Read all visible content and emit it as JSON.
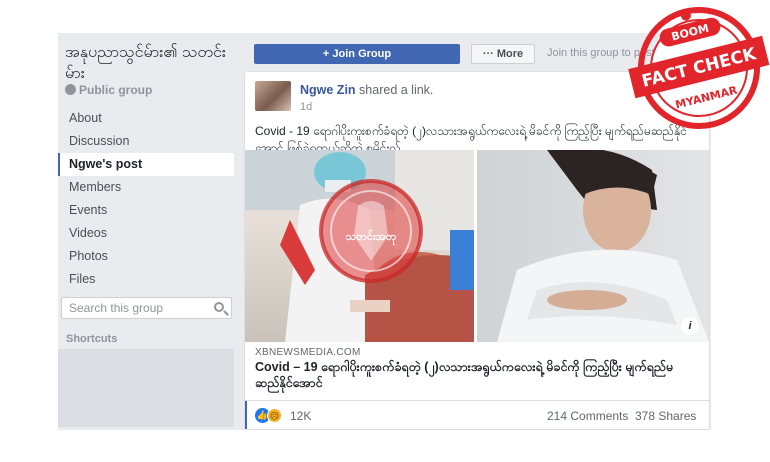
{
  "group": {
    "title": "အနုပညာသွင်မ်ား၏ သတင်းမ်ား",
    "type_label": "Public group"
  },
  "nav": {
    "items": [
      {
        "label": "About"
      },
      {
        "label": "Discussion"
      },
      {
        "label": "Ngwe's post"
      },
      {
        "label": "Members"
      },
      {
        "label": "Events"
      },
      {
        "label": "Videos"
      },
      {
        "label": "Photos"
      },
      {
        "label": "Files"
      }
    ],
    "active_index": 2
  },
  "search": {
    "placeholder": "Search this group"
  },
  "shortcuts": {
    "label": "Shortcuts"
  },
  "actions": {
    "join_label": "+ Join Group",
    "more_label": "··· More",
    "join_hint": "Join this group to post"
  },
  "post": {
    "author": "Ngwe Zin",
    "action": "shared a link.",
    "time": "1d",
    "text": "Covid - 19 ရောဂါပိုးကူးစက်ခံရတဲ့ (၂)လသားအရွယ်ကလေးရဲ့ မိခင်ကို ကြည့်ပြီး မျက်ရည်မဆည်နိုင်အောင် ဖြစ်ခဲ့ရတယ်ဆိုတဲ့ စမိုင်းလ်",
    "info_label": "i",
    "link": {
      "domain": "XBNEWSMEDIA.COM",
      "title": "Covid – 19 ရောဂါပိုးကူးစက်ခံရတဲ့ (၂)လသားအရွယ်ကလေးရဲ့ မိခင်ကို ကြည့်ပြီး မျက်ရည်မဆည်နိုင်အောင်"
    },
    "stats": {
      "reactions": "12K",
      "comments": "214 Comments",
      "shares": "378 Shares"
    }
  },
  "overlays": {
    "stamp_text": "သတင်းအတု",
    "badge": {
      "top": "BOOM",
      "main": "FACT CHECK",
      "bottom": "MYANMAR"
    }
  },
  "colors": {
    "facebook_blue": "#4267b2",
    "badge_red": "#e2252b",
    "stamp_red": "#e03a3a"
  }
}
